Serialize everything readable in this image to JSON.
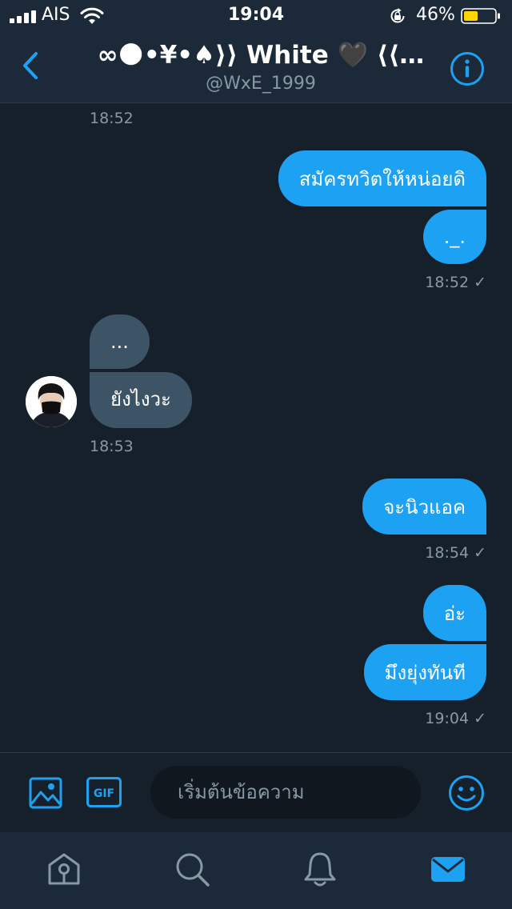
{
  "status_bar": {
    "carrier": "AIS",
    "time": "19:04",
    "battery_pct": "46%",
    "battery_level": 0.46,
    "icons": [
      "signal-icon",
      "wifi-icon",
      "rotation-lock-icon",
      "battery-icon"
    ]
  },
  "header": {
    "title": "∞🌑•¥•♠⟩⟩ White 🖤 ⟨⟨…",
    "handle": "@WxE_1999",
    "icons": [
      "back-icon",
      "info-icon"
    ]
  },
  "conversation": {
    "timestamps": [
      "18:52",
      "18:52 ✓",
      "18:53",
      "18:54 ✓",
      "19:04 ✓"
    ],
    "messages": [
      {
        "direction": "out",
        "text": "สมัครทวิตให้หน่อยดิ"
      },
      {
        "direction": "out",
        "text": "._."
      },
      {
        "direction": "in",
        "text": "..."
      },
      {
        "direction": "in",
        "text": "ยังไงวะ"
      },
      {
        "direction": "out",
        "text": "จะนิวแอค"
      },
      {
        "direction": "out",
        "text": "อ่ะ"
      },
      {
        "direction": "out",
        "text": "มึงยุ่งทันที"
      }
    ]
  },
  "composer": {
    "placeholder": "เริ่มต้นข้อความ",
    "gif_label": "GIF",
    "icons": [
      "image-icon",
      "gif-icon",
      "emoji-icon"
    ]
  },
  "tab_bar": {
    "tabs": [
      "home",
      "search",
      "notifications",
      "messages"
    ],
    "active": "messages"
  },
  "colors": {
    "background": "#15202b",
    "bar": "#1c2938",
    "accent": "#1da1f2",
    "incoming_bubble": "#3d5466",
    "muted_text": "#8899a6",
    "battery": "#ffd400"
  }
}
